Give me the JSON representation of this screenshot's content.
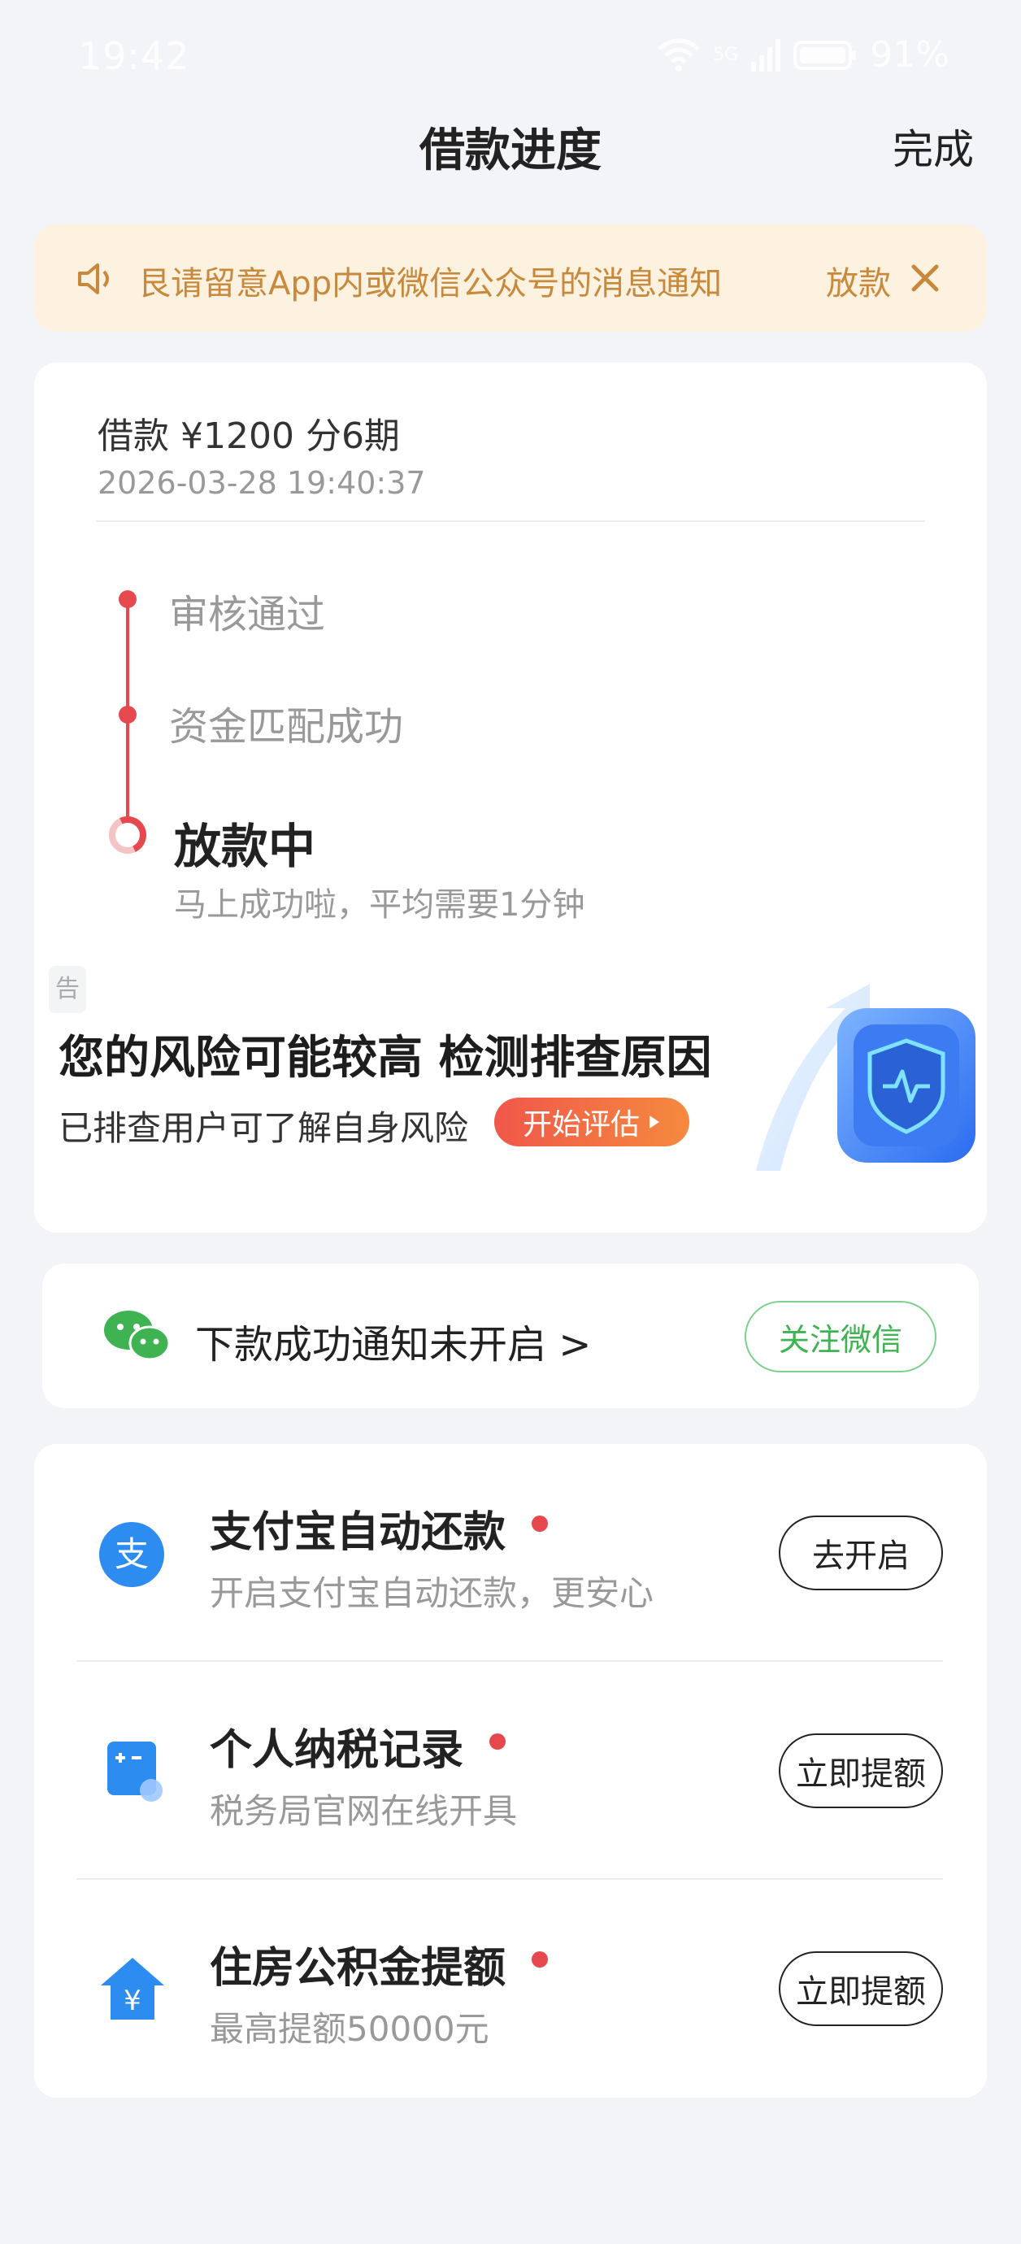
{
  "status_bar": {
    "time": "19:42",
    "network": "5G",
    "battery": "91%"
  },
  "header": {
    "title": "借款进度",
    "done_label": "完成"
  },
  "notice": {
    "text": "艮请留意App内或微信公众号的消息通知",
    "trailing_text": "放款",
    "icon": "speaker-icon"
  },
  "loan": {
    "summary": "借款 ¥1200  分6期",
    "datetime": "2026-03-28 19:40:37",
    "steps": [
      {
        "label": "审核通过",
        "status": "done"
      },
      {
        "label": "资金匹配成功",
        "status": "done"
      },
      {
        "label": "放款中",
        "status": "current",
        "desc": "马上成功啦，平均需要1分钟"
      }
    ],
    "accent_color": "#e5484d"
  },
  "risk_banner": {
    "tag": "告",
    "title": "您的风险可能较高 检测排查原因",
    "subtitle": "已排查用户可了解自身风险",
    "button_label": "开始评估"
  },
  "wechat": {
    "text": "下款成功通知未开启 >",
    "button_label": "关注微信",
    "icon": "wechat-icon"
  },
  "services": [
    {
      "icon": "alipay-icon",
      "title": "支付宝自动还款",
      "desc": "开启支付宝自动还款，更安心",
      "button": "去开启"
    },
    {
      "icon": "calculator-icon",
      "title": "个人纳税记录",
      "desc": "税务局官网在线开具",
      "button": "立即提额"
    },
    {
      "icon": "house-yuan-icon",
      "title": "住房公积金提额",
      "desc": "最高提额50000元",
      "button": "立即提额"
    }
  ]
}
